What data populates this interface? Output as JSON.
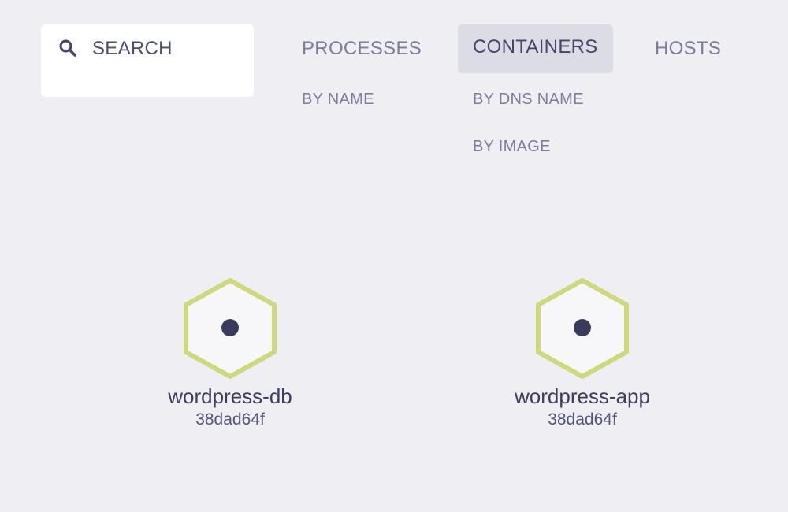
{
  "search": {
    "label": "SEARCH",
    "icon": "search-icon"
  },
  "topologies": [
    {
      "label": "PROCESSES",
      "active": false,
      "sub": [
        "BY NAME"
      ]
    },
    {
      "label": "CONTAINERS",
      "active": true,
      "sub": [
        "BY DNS NAME",
        "BY IMAGE"
      ]
    },
    {
      "label": "HOSTS",
      "active": false,
      "sub": []
    }
  ],
  "nodes": [
    {
      "label": "wordpress-db",
      "sublabel": "38dad64f",
      "shape": "hexagon-icon"
    },
    {
      "label": "wordpress-app",
      "sublabel": "38dad64f",
      "shape": "hexagon-icon"
    }
  ],
  "colors": {
    "background": "#eeeef3",
    "node_stroke": "#cfd87a",
    "node_fill": "#f7f7fa",
    "node_dot": "#3a3a5c",
    "active_tab_bg": "#dcdce4"
  }
}
